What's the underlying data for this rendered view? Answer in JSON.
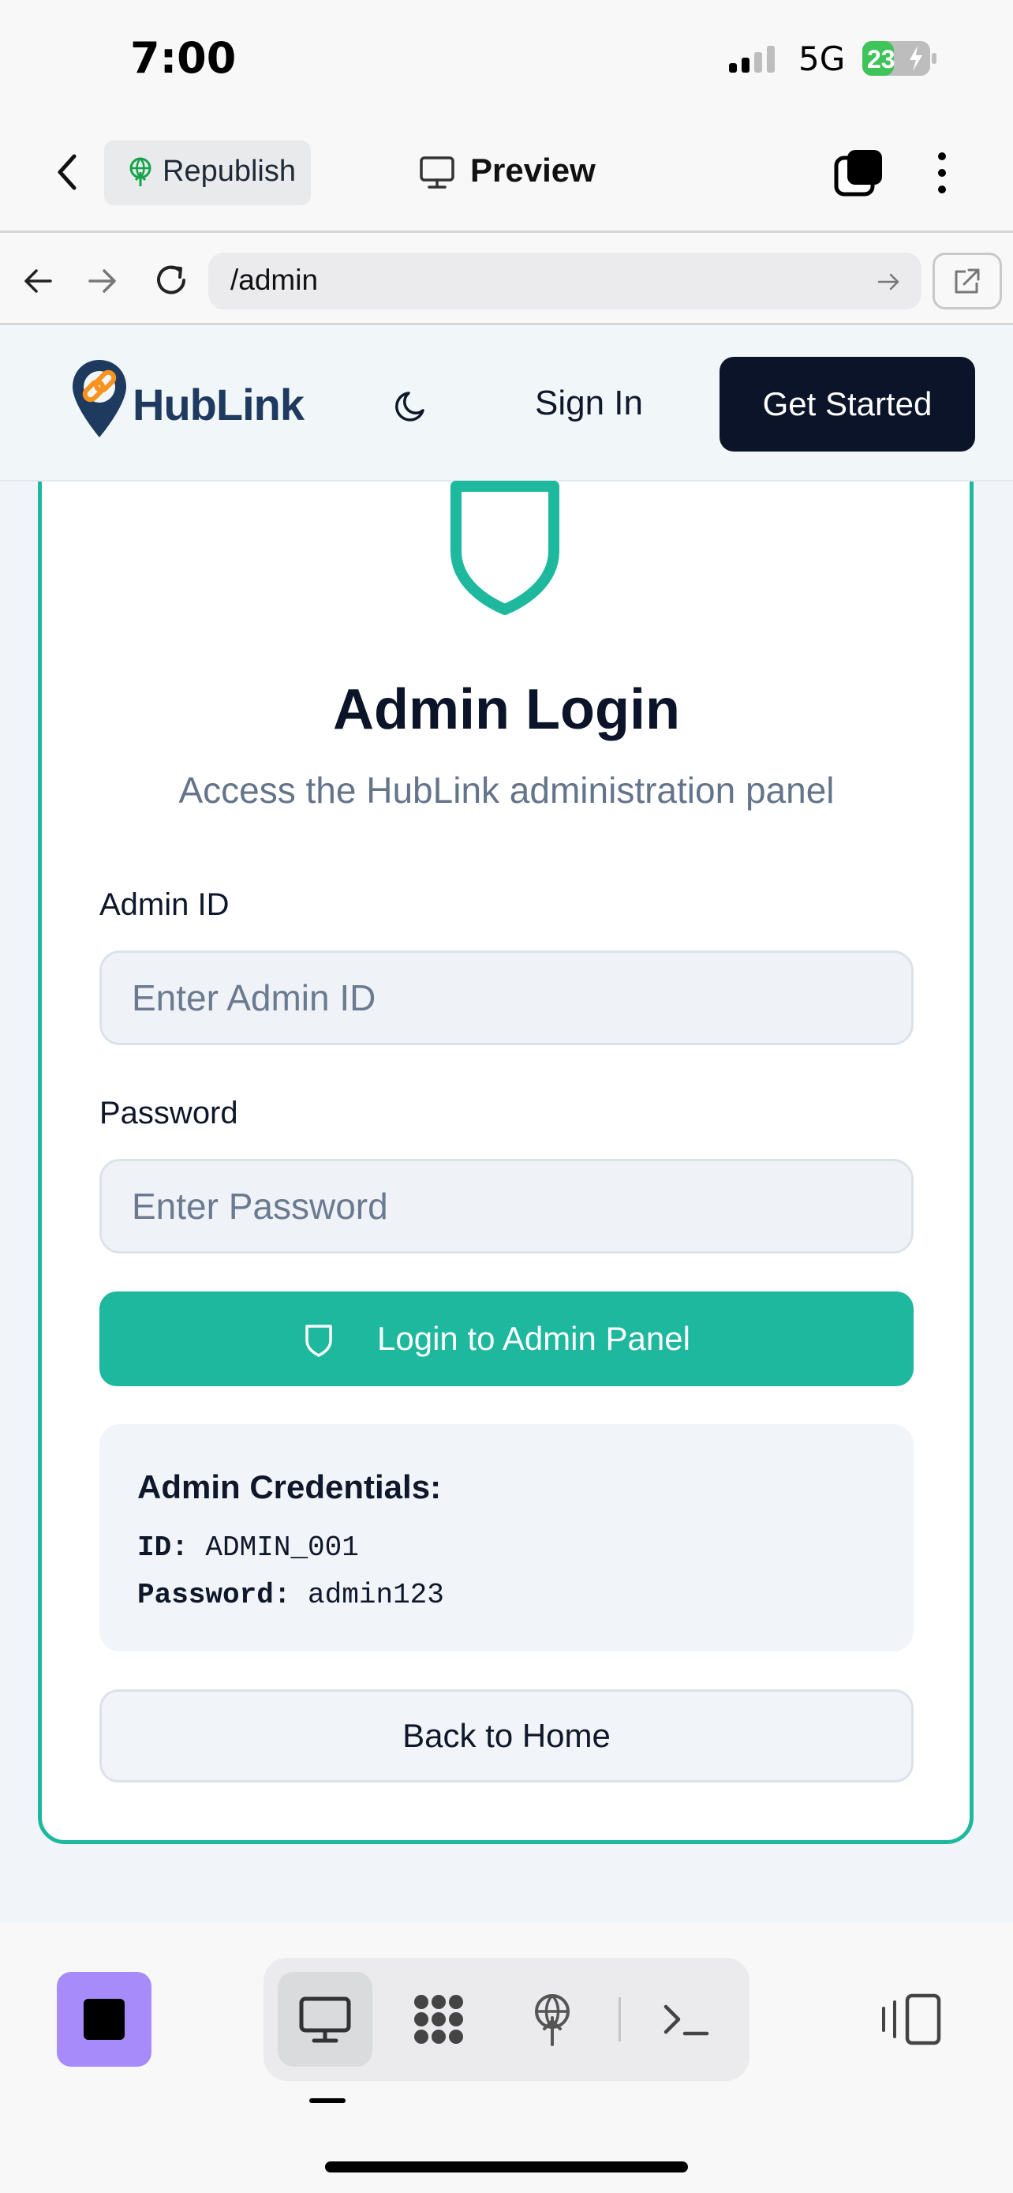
{
  "status_bar": {
    "time": "7:00",
    "network": "5G",
    "battery": "23"
  },
  "toolbar": {
    "republish_label": "Republish",
    "preview_label": "Preview"
  },
  "browser": {
    "url": "/admin"
  },
  "header": {
    "logo_text": "HubLink",
    "signin_label": "Sign In",
    "get_started_label": "Get Started"
  },
  "login": {
    "title": "Admin Login",
    "subtitle": "Access the HubLink administration panel",
    "admin_id_label": "Admin ID",
    "admin_id_placeholder": "Enter Admin ID",
    "password_label": "Password",
    "password_placeholder": "Enter Password",
    "submit_label": "Login to Admin Panel",
    "credentials": {
      "title": "Admin Credentials:",
      "id_key": "ID:",
      "id_value": "ADMIN_001",
      "password_key": "Password:",
      "password_value": "admin123"
    },
    "back_home_label": "Back to Home"
  },
  "colors": {
    "accent": "#1db89d",
    "header_dark": "#0b1428",
    "stop_button": "#a78bfa",
    "logo_orange": "#f7931e",
    "logo_navy": "#1e3a5f"
  },
  "icons": {
    "shield": "shield-icon",
    "moon": "moon-icon",
    "preview": "monitor-icon"
  }
}
